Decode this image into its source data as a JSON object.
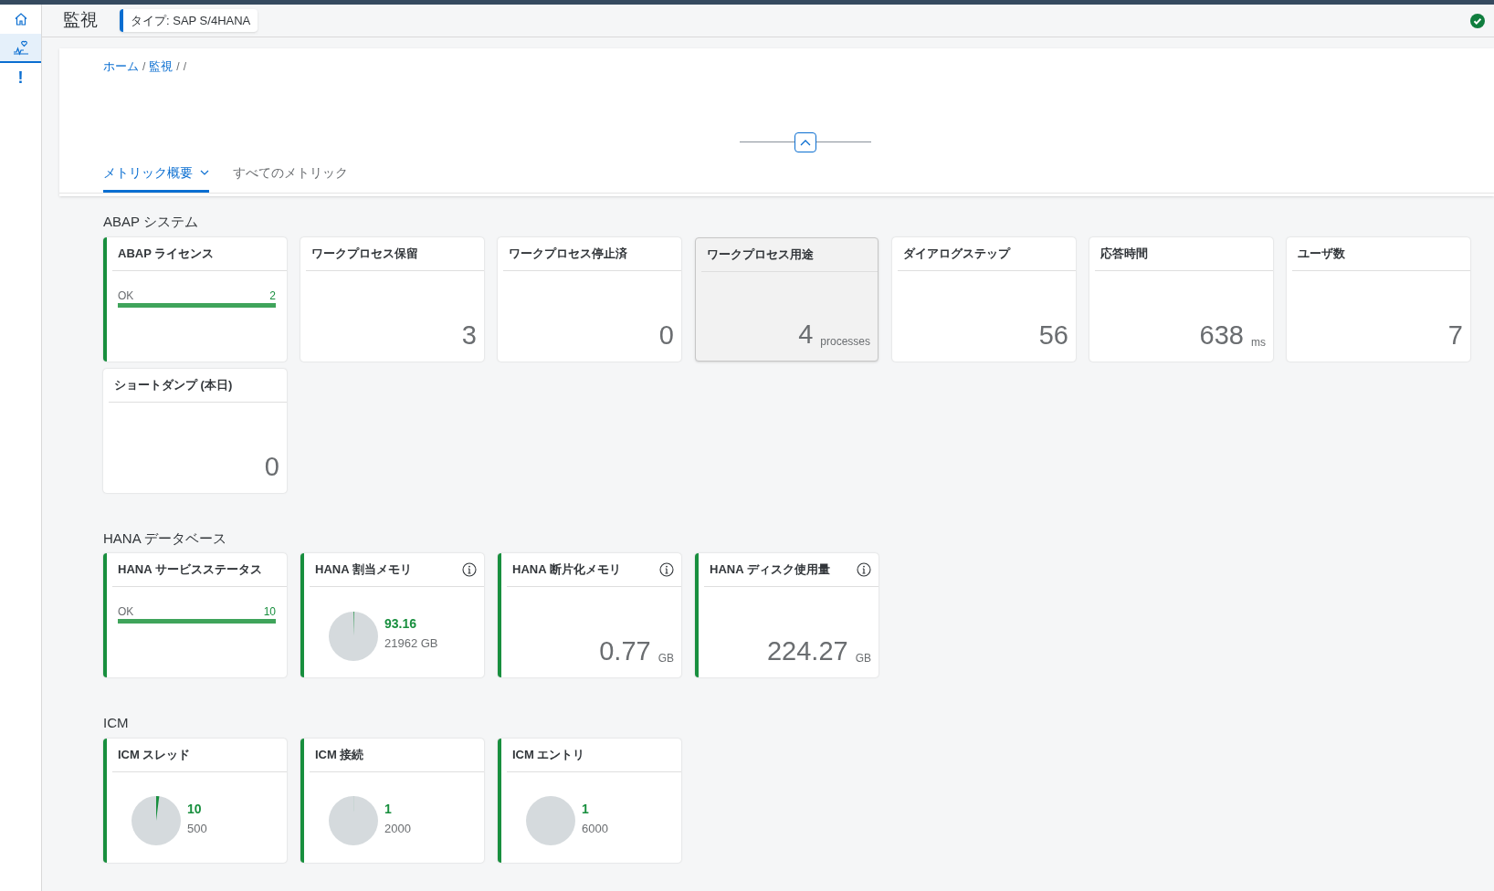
{
  "sidebar": {
    "items": [
      {
        "kind": "home",
        "selected": false
      },
      {
        "kind": "monitor",
        "selected": true
      },
      {
        "kind": "alert",
        "selected": false,
        "label": "!"
      }
    ]
  },
  "header": {
    "title": "監視",
    "type_badge": "タイプ: SAP S/4HANA"
  },
  "breadcrumb": [
    {
      "kind": "link",
      "text": "ホーム"
    },
    {
      "kind": "separator",
      "text": "/"
    },
    {
      "kind": "link",
      "text": "監視"
    },
    {
      "kind": "separator",
      "text": "/"
    },
    {
      "kind": "separator",
      "text": "/"
    }
  ],
  "tabs": [
    {
      "label": "メトリック概要",
      "selected": true,
      "dropdown": true
    },
    {
      "label": "すべてのメトリック",
      "selected": false,
      "dropdown": false
    }
  ],
  "sections": [
    {
      "title": "ABAP システム",
      "tiles": [
        {
          "kind": "bar",
          "title": "ABAP ライセンス",
          "color": "#188f3e",
          "info": false,
          "hovered": false,
          "label": "OK",
          "value": "2"
        },
        {
          "kind": "number",
          "title": "ワークプロセス保留",
          "info": false,
          "hovered": false,
          "value": "3"
        },
        {
          "kind": "number",
          "title": "ワークプロセス停止済",
          "info": false,
          "hovered": false,
          "value": "0"
        },
        {
          "kind": "number",
          "title": "ワークプロセス用途",
          "info": false,
          "hovered": true,
          "value": "4",
          "unit": "processes"
        },
        {
          "kind": "number",
          "title": "ダイアログステップ",
          "info": false,
          "hovered": false,
          "value": "56"
        },
        {
          "kind": "number",
          "title": "応答時間",
          "info": false,
          "hovered": false,
          "value": "638",
          "unit": "ms"
        },
        {
          "kind": "number",
          "title": "ユーザ数",
          "info": false,
          "hovered": false,
          "value": "7"
        },
        {
          "kind": "number",
          "title": "ショートダンプ (本日)",
          "info": false,
          "hovered": false,
          "value": "0"
        }
      ]
    },
    {
      "title": "HANA データベース",
      "tiles": [
        {
          "kind": "bar",
          "title": "HANA サービスステータス",
          "color": "#188f3e",
          "info": false,
          "hovered": false,
          "label": "OK",
          "value": "10"
        },
        {
          "kind": "pie",
          "title": "HANA 割当メモリ",
          "color": "#188f3e",
          "info": true,
          "hovered": false,
          "value": "93.16",
          "total": "21962 GB"
        },
        {
          "kind": "number",
          "title": "HANA 断片化メモリ",
          "color": "#188f3e",
          "info": true,
          "hovered": false,
          "value": "0.77",
          "unit": "GB"
        },
        {
          "kind": "number",
          "title": "HANA ディスク使用量",
          "color": "#188f3e",
          "info": true,
          "hovered": false,
          "value": "224.27",
          "unit": "GB"
        }
      ]
    },
    {
      "title": "ICM",
      "tiles": [
        {
          "kind": "pie",
          "title": "ICM スレッド",
          "color": "#188f3e",
          "info": false,
          "hovered": false,
          "value": "10",
          "total": "500"
        },
        {
          "kind": "pie",
          "title": "ICM 接続",
          "color": "#188f3e",
          "info": false,
          "hovered": false,
          "value": "1",
          "total": "2000"
        },
        {
          "kind": "pie",
          "title": "ICM エントリ",
          "color": "#188f3e",
          "info": false,
          "hovered": false,
          "value": "1",
          "total": "6000"
        }
      ]
    }
  ]
}
